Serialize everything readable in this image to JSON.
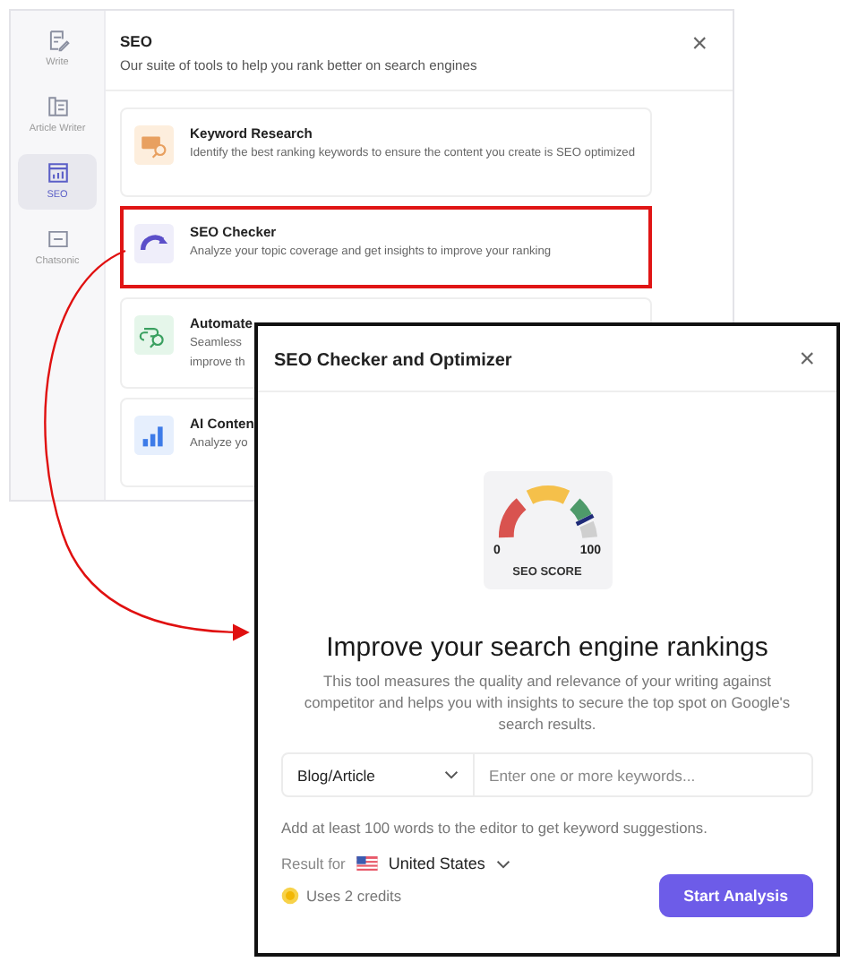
{
  "back_panel": {
    "sidebar": [
      {
        "label": "Write",
        "selected": false
      },
      {
        "label": "Article Writer",
        "selected": false
      },
      {
        "label": "SEO",
        "selected": true
      },
      {
        "label": "Chatsonic",
        "selected": false
      }
    ],
    "title": "SEO",
    "subtitle": "Our suite of tools to help you rank better on search engines",
    "close": "×",
    "tools": [
      {
        "title": "Keyword Research",
        "description": "Identify the best ranking keywords to ensure the content you create is SEO optimized",
        "highlighted": false
      },
      {
        "title": "SEO Checker",
        "description": "Analyze your topic coverage and get insights to improve your ranking",
        "highlighted": true
      },
      {
        "title": "Automate",
        "description": "Seamless improve th",
        "highlighted": false
      },
      {
        "title": "AI Conten",
        "description": "Analyze yo",
        "highlighted": false
      }
    ]
  },
  "dialog": {
    "title": "SEO Checker and Optimizer",
    "close": "×",
    "gauge": {
      "min": "0",
      "max": "100",
      "label": "SEO SCORE"
    },
    "heading": "Improve your search engine rankings",
    "description": "This tool measures the quality and relevance of your writing against competitor and helps you with insights to secure the top spot on Google's search results.",
    "content_type": "Blog/Article",
    "keywords_placeholder": "Enter one or more keywords...",
    "hint": "Add at least 100 words to the editor to get keyword suggestions.",
    "result_for": "Result for",
    "country": "United States",
    "credits": "Uses 2 credits",
    "button": "Start Analysis"
  }
}
